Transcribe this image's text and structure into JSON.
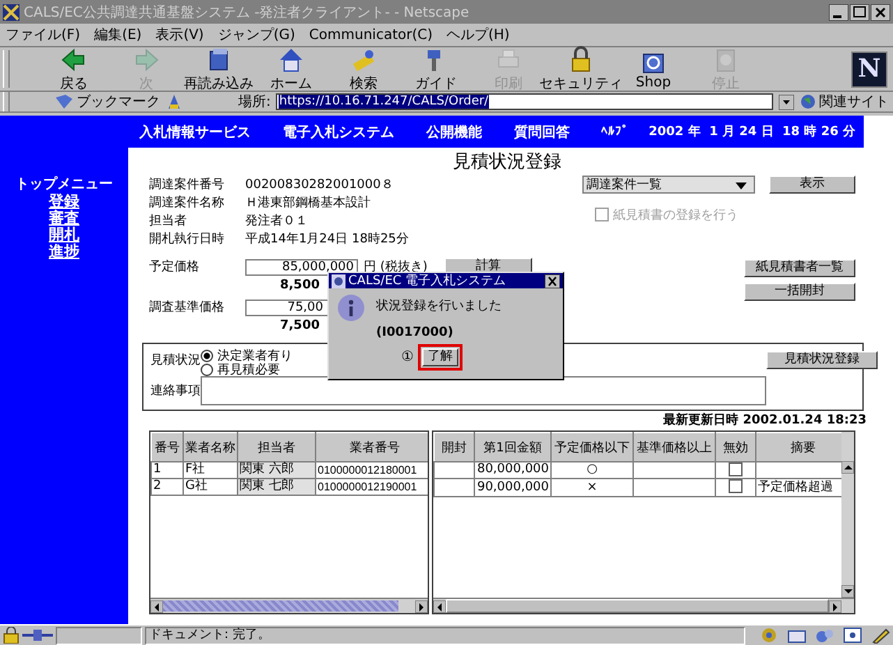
{
  "window": {
    "title": "CALS/EC公共調達共通基盤システム -発注者クライアント- - Netscape"
  },
  "menu": [
    "ファイル(F)",
    "編集(E)",
    "表示(V)",
    "ジャンプ(G)",
    "Communicator(C)",
    "ヘルプ(H)"
  ],
  "toolbar": [
    {
      "label": "戻る",
      "disabled": false
    },
    {
      "label": "次",
      "disabled": true
    },
    {
      "label": "再読み込み",
      "disabled": false
    },
    {
      "label": "ホーム",
      "disabled": false
    },
    {
      "label": "検索",
      "disabled": false
    },
    {
      "label": "ガイド",
      "disabled": false
    },
    {
      "label": "印刷",
      "disabled": true
    },
    {
      "label": "セキュリティ",
      "disabled": false
    },
    {
      "label": "Shop",
      "disabled": false
    },
    {
      "label": "停止",
      "disabled": true
    }
  ],
  "logo": "N",
  "location_bar": {
    "bookmarks": "ブックマーク",
    "label": "場所:",
    "url": "https://10.16.71.247/CALS/Order/",
    "related": "関連サイト"
  },
  "nav": {
    "items": [
      "入札情報サービス",
      "電子入札システム",
      "公開機能",
      "質問回答"
    ],
    "help": "ﾍﾙﾌﾟ",
    "date": "2002 年  1 月 24 日  18 時 26 分"
  },
  "side_menu": {
    "title": "トップメニュー",
    "items": [
      "登録",
      "審査",
      "開札",
      "進捗"
    ]
  },
  "page_title": "見積状況登録",
  "case_select": "調達案件一覧",
  "show_button": "表示",
  "paper_checkbox": {
    "label": "紙見積書の登録を行う",
    "checked": false,
    "disabled": true
  },
  "details": [
    {
      "label": "調達案件番号",
      "value": "00200830282001000８"
    },
    {
      "label": "調達案件名称",
      "value": "Ｈ港東部鋼橋基本設計"
    },
    {
      "label": "担当者",
      "value": "発注者０１"
    },
    {
      "label": "開札執行日時",
      "value": "平成14年1月24日 18時25分"
    }
  ],
  "prices": [
    {
      "label": "予定価格",
      "value": "85,000,000",
      "unit": "円 (税抜き)",
      "amount": "8,500"
    },
    {
      "label": "調査基準価格",
      "value": "75,00",
      "amount": "7,500"
    }
  ],
  "calc_button": "計算",
  "side_buttons": [
    "紙見積書者一覧",
    "一括開封"
  ],
  "status_box": {
    "label": "見積状況",
    "options": [
      {
        "label": "決定業者有り",
        "selected": true
      },
      {
        "label": "再見積必要",
        "selected": false
      }
    ],
    "notes_label": "連絡事項",
    "register_button": "見積状況登録"
  },
  "updated": "最新更新日時 2002.01.24 18:23",
  "left_table": {
    "columns": [
      "番号",
      "業者名称",
      "担当者",
      "業者番号"
    ],
    "rows": [
      [
        "1",
        "F社",
        "関東 六郎",
        "0100000012180001"
      ],
      [
        "2",
        "G社",
        "関東 七郎",
        "0100000012190001"
      ]
    ]
  },
  "right_table": {
    "columns": [
      "開封",
      "第1回金額",
      "予定価格以下",
      "基準価格以上",
      "無効",
      "摘要"
    ],
    "rows": [
      {
        "amount": "80,000,000",
        "below_planned": "○",
        "invalid": false
      },
      {
        "amount": "90,000,000",
        "below_planned": "×",
        "invalid": false,
        "note": "予定価格超過"
      }
    ]
  },
  "dialog": {
    "title": "CALS/EC 電子入札システム",
    "message": "状況登録を行いました",
    "code": "(I0017000)",
    "marker": "①",
    "ok_button": "了解"
  },
  "status_bar": {
    "text": "ドキュメント: 完了。"
  }
}
